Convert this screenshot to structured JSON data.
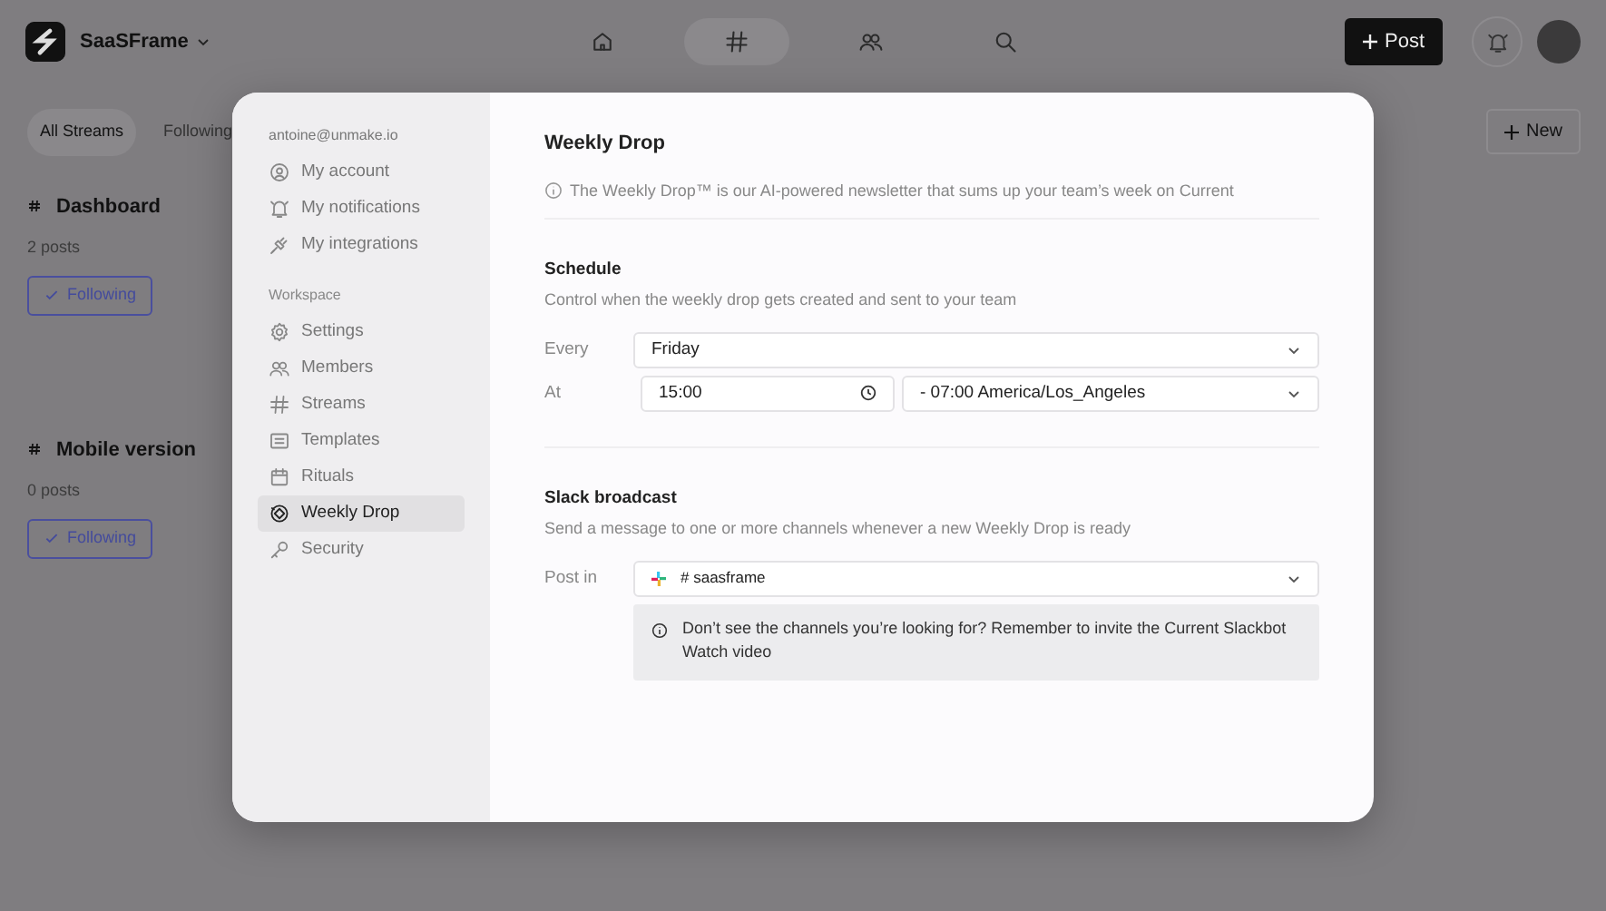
{
  "topbar": {
    "workspace": "SaaSFrame",
    "nav": [
      {
        "selected": false
      },
      {
        "selected": true
      },
      {
        "selected": false
      },
      {
        "selected": false
      }
    ],
    "post_button": "Post"
  },
  "filters": {
    "tabs": [
      {
        "label": "All Streams",
        "selected": true
      },
      {
        "label": "Following",
        "selected": false
      }
    ],
    "new_button": "New"
  },
  "streams": [
    {
      "name": "Dashboard",
      "count": "2 posts",
      "follow_label": "Following"
    },
    {
      "name": "Mobile version",
      "count": "0 posts",
      "follow_label": "Following"
    }
  ],
  "modal": {
    "account_email": "antoine@unmake.io",
    "personal_items": [
      {
        "label": "My account",
        "selected": false
      },
      {
        "label": "My notifications",
        "selected": false
      },
      {
        "label": "My integrations",
        "selected": false
      }
    ],
    "workspace_heading": "Workspace",
    "workspace_items": [
      {
        "label": "Settings",
        "selected": false
      },
      {
        "label": "Members",
        "selected": false
      },
      {
        "label": "Streams",
        "selected": false
      },
      {
        "label": "Templates",
        "selected": false
      },
      {
        "label": "Rituals",
        "selected": false
      },
      {
        "label": "Weekly Drop",
        "selected": true
      },
      {
        "label": "Security",
        "selected": false
      }
    ],
    "title": "Weekly Drop",
    "intro": "The Weekly Drop™ is our AI-powered newsletter that sums up your team’s week on Current",
    "schedule": {
      "title": "Schedule",
      "description": "Control when the weekly drop gets created and sent to your team",
      "every_label": "Every",
      "every_value": "Friday",
      "at_label": "At",
      "time_value": "15:00",
      "timezone_value": "- 07:00 America/Los_Angeles"
    },
    "slack": {
      "title": "Slack broadcast",
      "description": "Send a message to one or more channels whenever a new Weekly Drop is ready",
      "post_in_label": "Post in",
      "channel": "# saasframe",
      "notice_lines": [
        "Don’t see the channels you’re looking for? Remember to invite the Current Slackbot",
        "Watch video"
      ]
    }
  }
}
